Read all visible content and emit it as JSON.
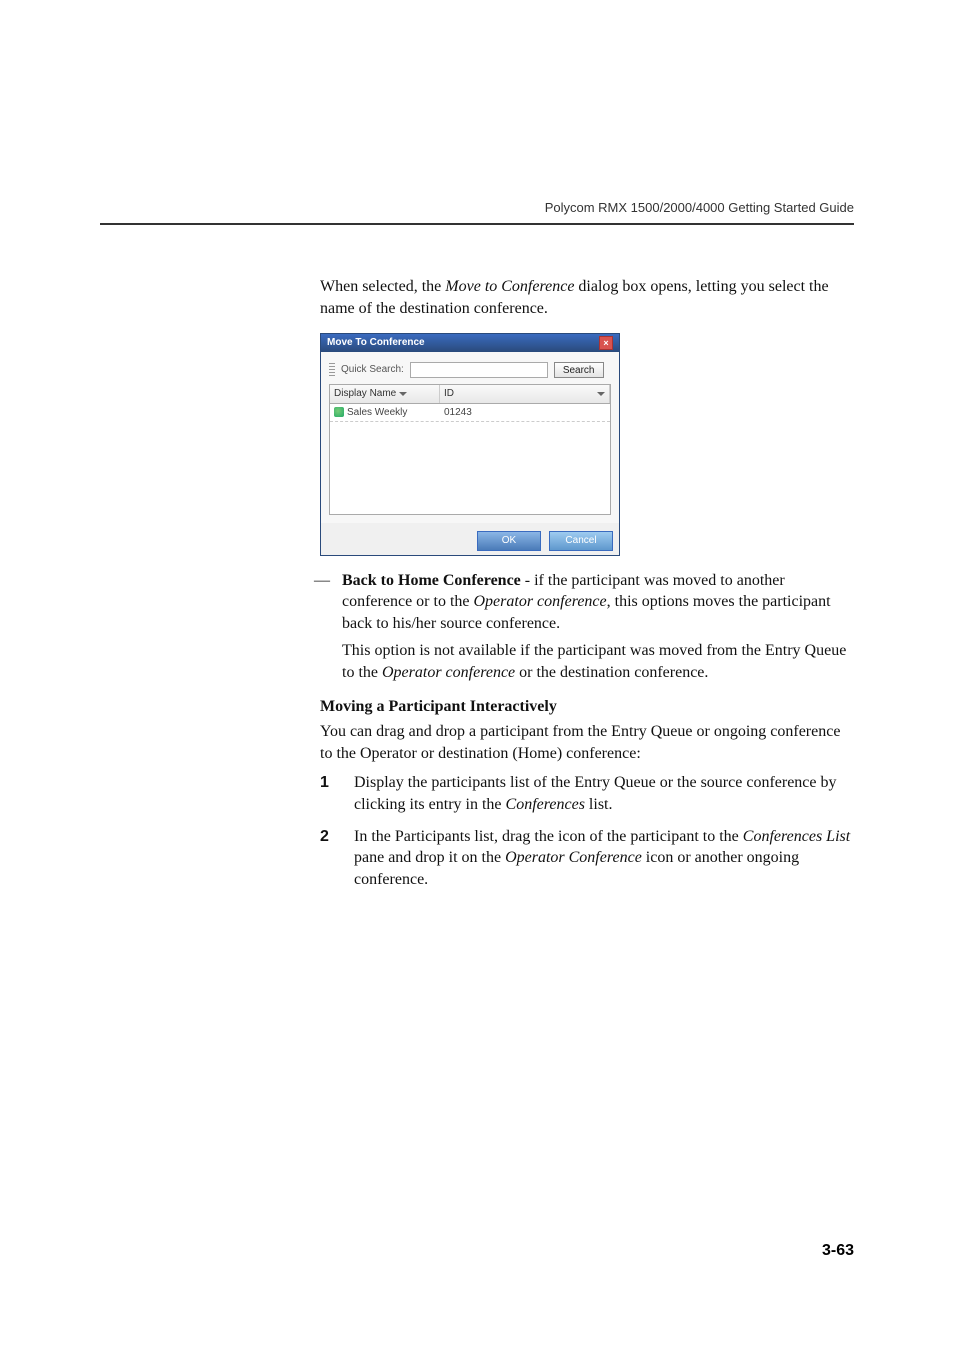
{
  "header": {
    "title": "Polycom RMX 1500/2000/4000 Getting Started Guide"
  },
  "intro": {
    "line1": "When selected, the ",
    "emph": "Move to Conference",
    "line1b": " dialog box opens, letting you select the name of the destination conference."
  },
  "dialog": {
    "title": "Move To Conference",
    "quick_search_label": "Quick Search:",
    "search_btn": "Search",
    "col1": "Display Name",
    "col2": "ID",
    "row_name": "Sales Weekly",
    "row_id": "01243",
    "ok": "OK",
    "cancel": "Cancel"
  },
  "bullet": {
    "strong": "Back to Home Conference",
    "rest": " - if the participant was moved to another conference or to the ",
    "emph1": "Operator conference",
    "rest2": ", this options moves the participant back to his/her source conference.",
    "para2a": "This option is not available if the participant was moved from the Entry Queue to the ",
    "emph2": "Operator conference",
    "para2b": " or the destination conference."
  },
  "subhead": "Moving a Participant Interactively",
  "sub_intro": "You can drag and drop a participant from the Entry Queue or ongoing conference to the Operator or destination (Home) conference:",
  "steps": {
    "s1a": "Display the participants list of the Entry Queue or the source conference by clicking its entry in the ",
    "s1emph": "Conferences",
    "s1b": " list.",
    "s2a": "In the Participants list, drag the icon of the participant to the ",
    "s2emph1": "Conferences List",
    "s2b": " pane and drop it on the ",
    "s2emph2": "Operator Conference",
    "s2c": " icon or another ongoing conference."
  },
  "page_number": "3-63"
}
